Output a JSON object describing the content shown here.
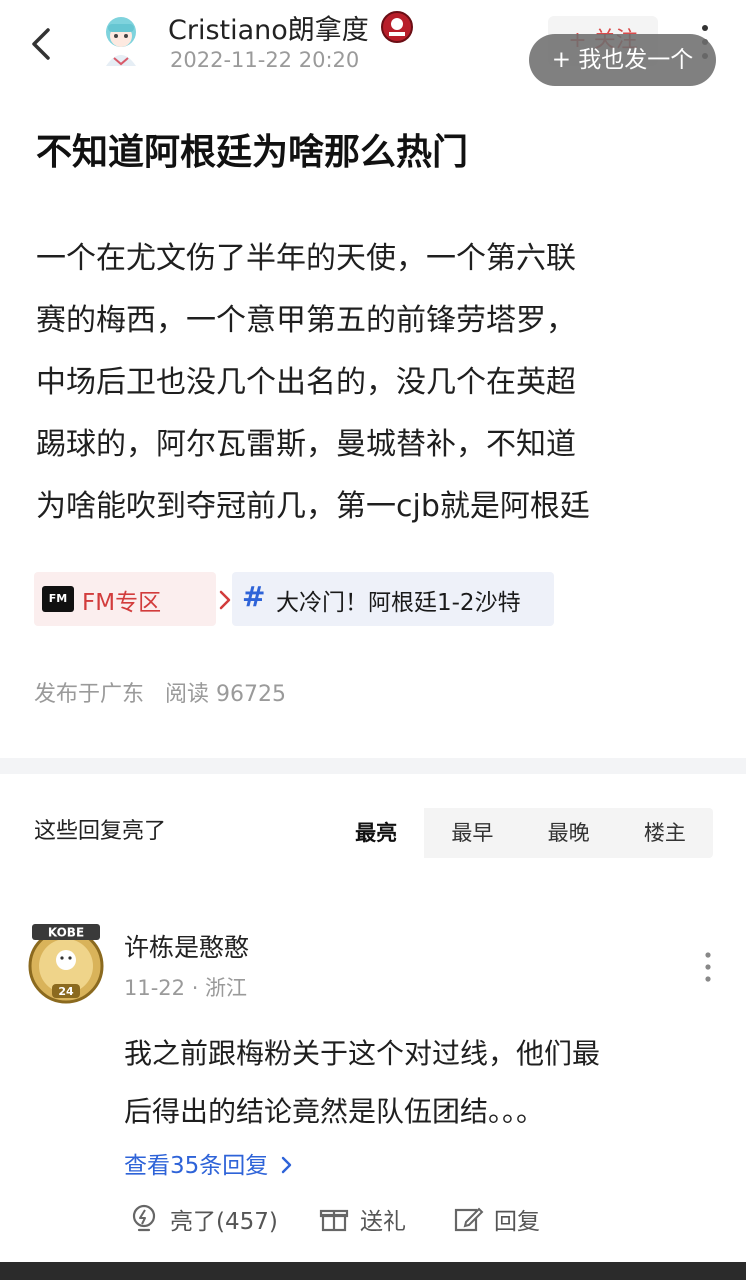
{
  "header": {
    "author": "Cristiano朗拿度",
    "date": "2022-11-22 20:20",
    "follow_label": "+ 关注",
    "post_button_label": "+ 我也发一个"
  },
  "post": {
    "title": "不知道阿根廷为啥那么热门",
    "body_lines": [
      "一个在尤文伤了半年的天使，一个第六联",
      "赛的梅西，一个意甲第五的前锋劳塔罗，",
      "中场后卫也没几个出名的，没几个在英超",
      "踢球的，阿尔瓦雷斯，曼城替补，不知道",
      "为啥能吹到夺冠前几，第一cjb就是阿根廷"
    ],
    "tags": {
      "fm_logo": "FM",
      "fm_label": "FM专区",
      "topic_label": "大冷门！阿根廷1-2沙特"
    },
    "location": "发布于广东",
    "reads": "阅读 96725"
  },
  "replies": {
    "title": "这些回复亮了",
    "sort_options": [
      "最亮",
      "最早",
      "最晚",
      "楼主"
    ],
    "sort_active": "最亮"
  },
  "comment": {
    "avatar_text": "KOBE",
    "avatar_number": "24",
    "username": "许栋是憨憨",
    "meta": "11-22 · 浙江",
    "text_lines": [
      "我之前跟梅粉关于这个对过线，他们最",
      "后得出的结论竟然是队伍团结。。。"
    ],
    "view_replies": "查看35条回复",
    "like_label": "亮了(457)",
    "gift_label": "送礼",
    "reply_label": "回复"
  },
  "colors": {
    "accent_red": "#d23c3c",
    "link_blue": "#2e63d8",
    "muted_gray": "#9a9a9a"
  }
}
